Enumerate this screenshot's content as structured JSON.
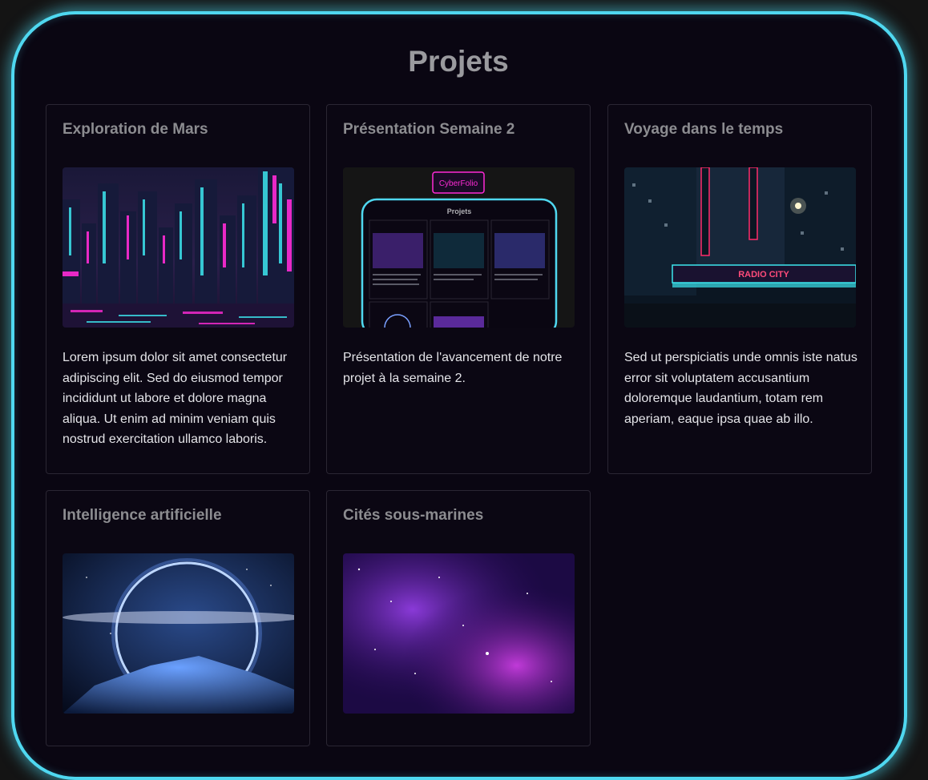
{
  "page": {
    "title": "Projets"
  },
  "projects": [
    {
      "title": "Exploration de Mars",
      "description": "Lorem ipsum dolor sit amet consectetur adipiscing elit. Sed do eiusmod tempor incididunt ut labore et dolore magna aliqua. Ut enim ad minim veniam quis nostrud exercitation ullamco laboris.",
      "image": "neon-city-skyline"
    },
    {
      "title": "Présentation Semaine 2",
      "description": "Présentation de l'avancement de notre projet à la semaine 2.",
      "image": "cyberfolio-screenshot",
      "image_labels": {
        "site_name": "CyberFolio",
        "inner_title": "Projets"
      }
    },
    {
      "title": "Voyage dans le temps",
      "description": "Sed ut perspiciatis unde omnis iste natus error sit voluptatem accusantium doloremque laudantium, totam rem aperiam, eaque ipsa quae ab illo.",
      "image": "radio-city-night",
      "image_labels": {
        "sign": "RADIO CITY"
      }
    },
    {
      "title": "Intelligence artificielle",
      "description": "",
      "image": "glowing-ring-planet"
    },
    {
      "title": "Cités sous-marines",
      "description": "",
      "image": "purple-nebula"
    }
  ],
  "colors": {
    "frame_glow": "#4fd8f0",
    "background": "#0a0612",
    "card_border": "#2a2633",
    "title_gray": "#9a9a9e"
  }
}
